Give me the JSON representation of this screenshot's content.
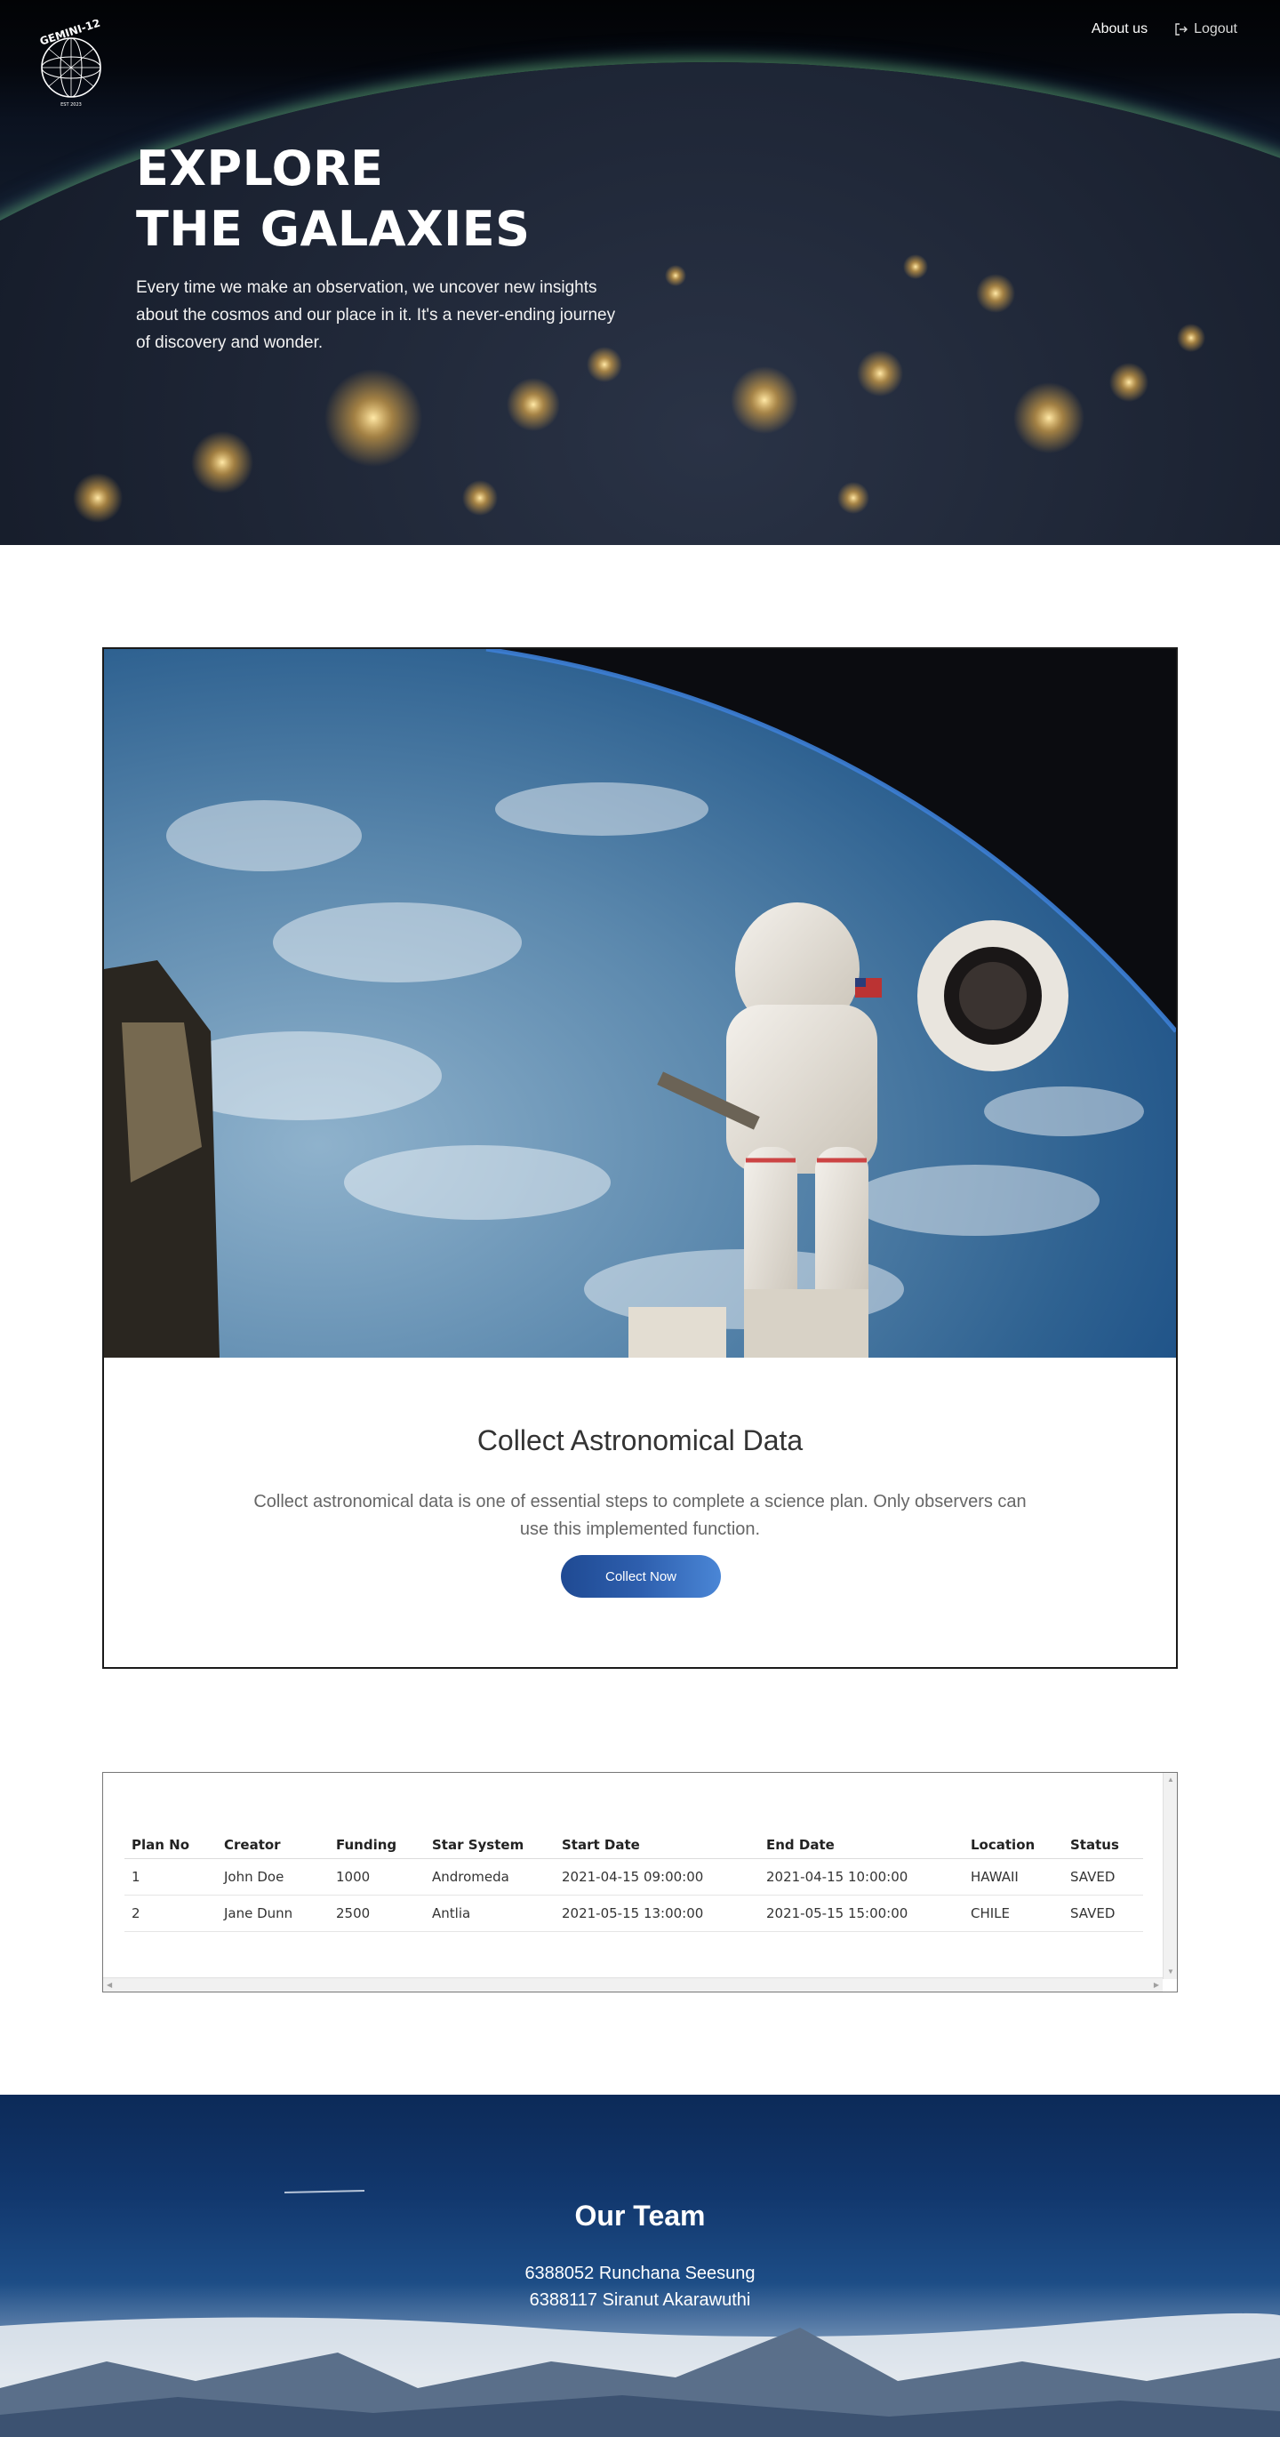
{
  "header": {
    "logo_text": "GEMINI-12",
    "logo_subtext": "EST 2023",
    "nav": {
      "about_label": "About us",
      "logout_label": "Logout"
    }
  },
  "hero": {
    "title_line1": "EXPLORE",
    "title_line2": "THE GALAXIES",
    "description": "Every time we make an observation, we uncover new insights about the cosmos and our place in it. It's a never-ending journey of discovery and wonder."
  },
  "collect_card": {
    "title": "Collect Astronomical Data",
    "description": "Collect astronomical data is one of essential steps to complete a science plan. Only observers can use this implemented function.",
    "button_label": "Collect Now"
  },
  "plans_table": {
    "columns": [
      "Plan No",
      "Creator",
      "Funding",
      "Star System",
      "Start Date",
      "End Date",
      "Location",
      "Status"
    ],
    "rows": [
      [
        "1",
        "John Doe",
        "1000",
        "Andromeda",
        "2021-04-15 09:00:00",
        "2021-04-15 10:00:00",
        "HAWAII",
        "SAVED"
      ],
      [
        "2",
        "Jane Dunn",
        "2500",
        "Antlia",
        "2021-05-15 13:00:00",
        "2021-05-15 15:00:00",
        "CHILE",
        "SAVED"
      ]
    ]
  },
  "footer": {
    "title": "Our Team",
    "members": [
      "6388052 Runchana Seesung",
      "6388117 Siranut Akarawuthi"
    ]
  },
  "colors": {
    "button_gradient_start": "#1f4a93",
    "button_gradient_end": "#4a86d6",
    "footer_sky": "#12386e"
  }
}
